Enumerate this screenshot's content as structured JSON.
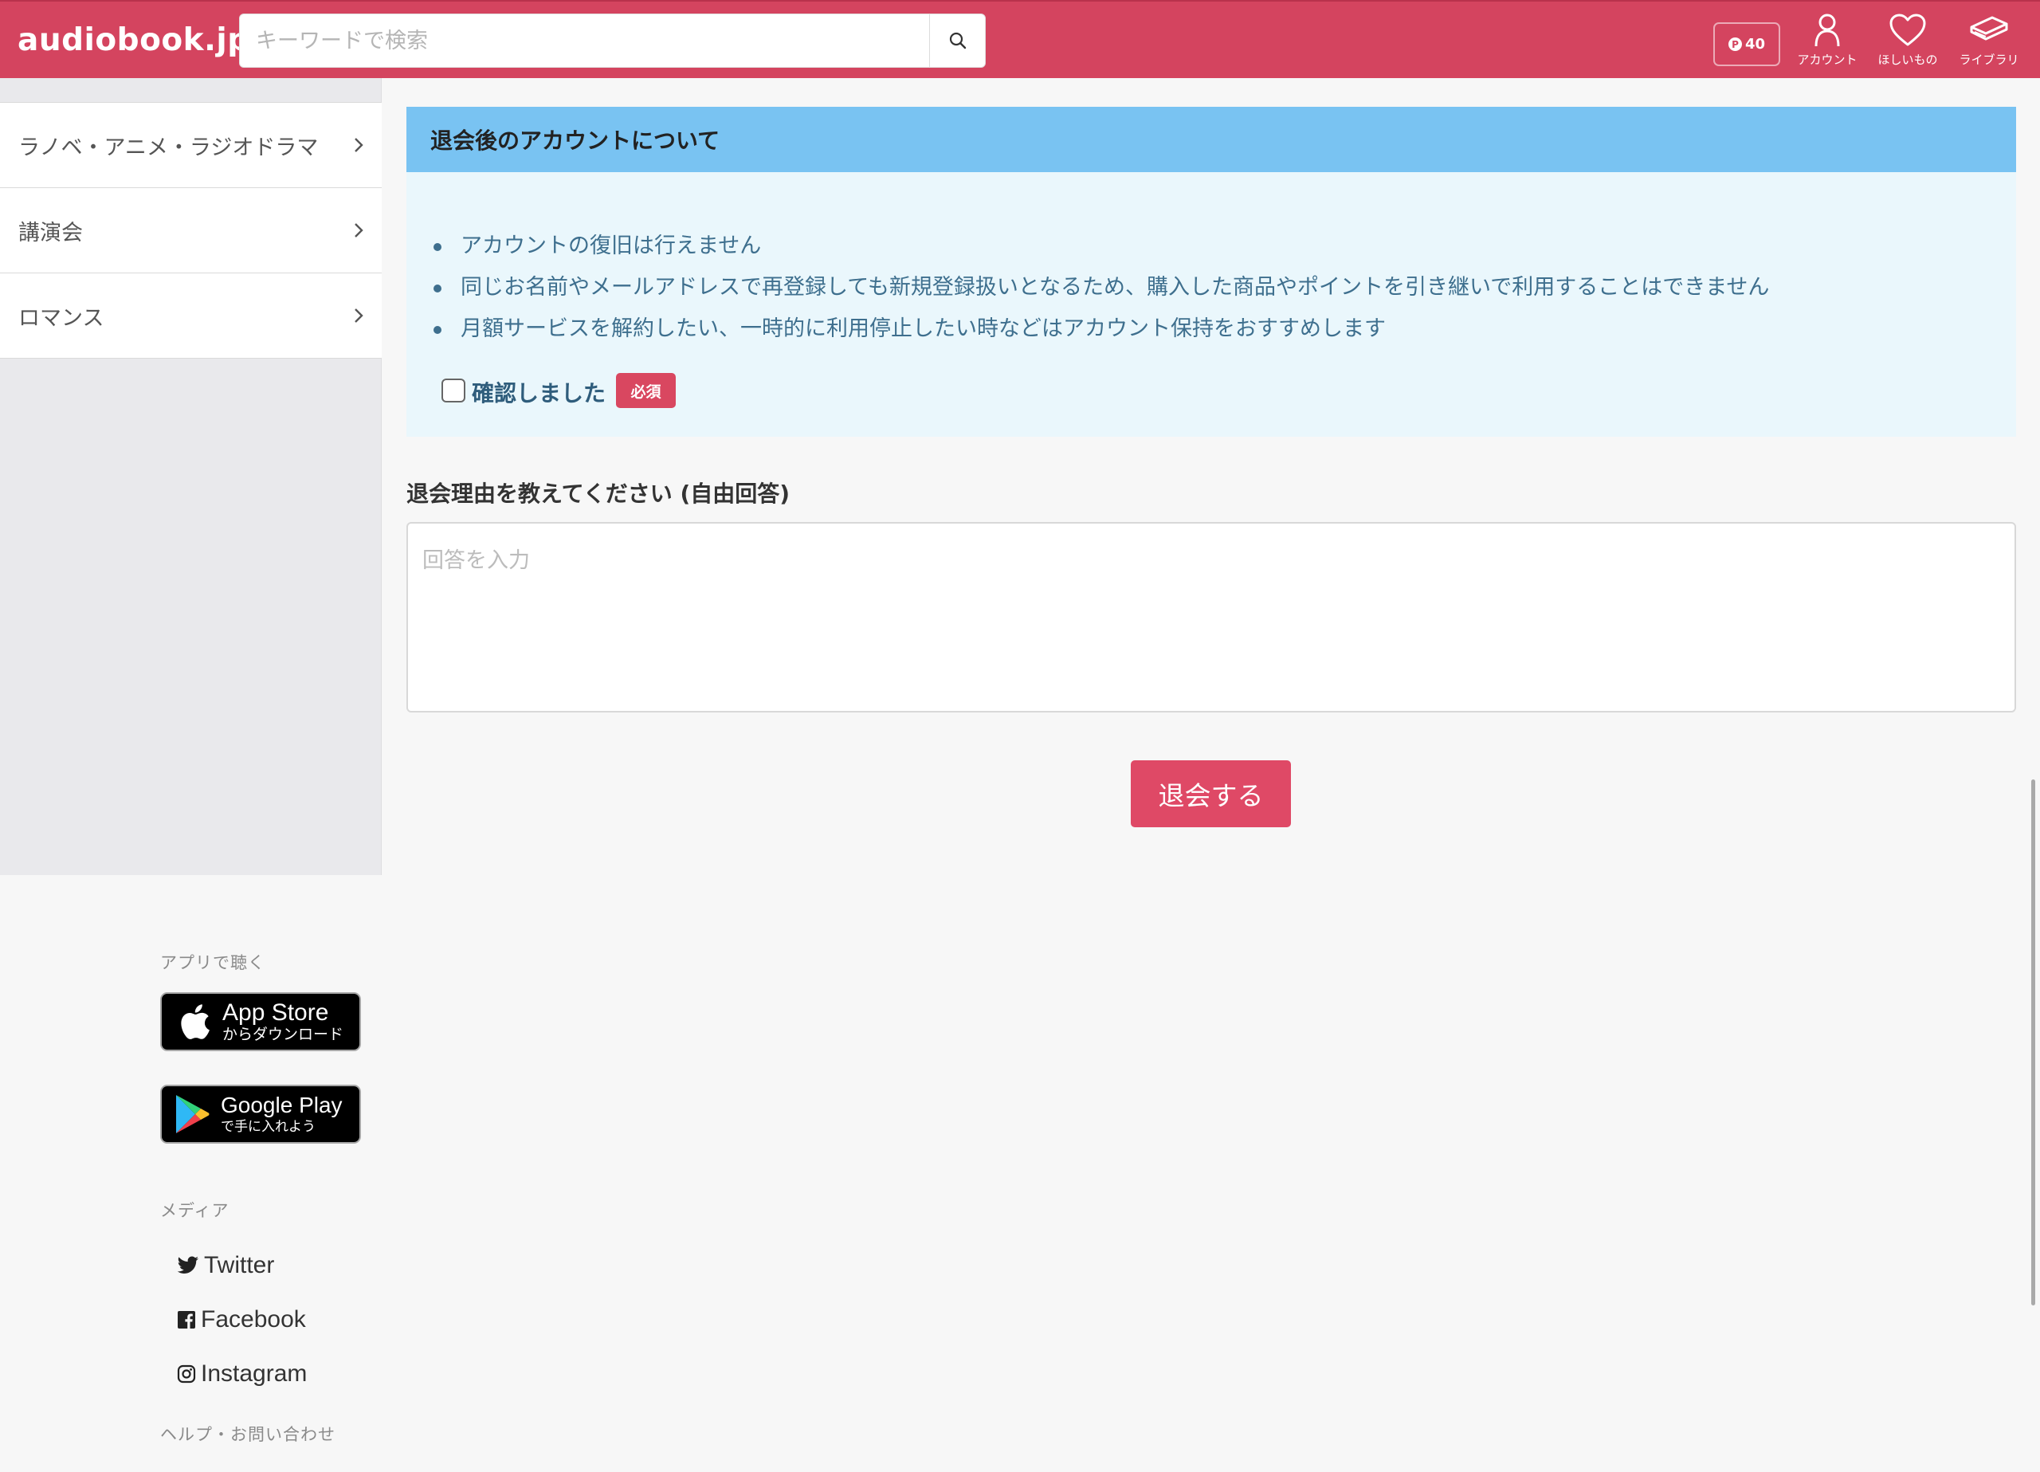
{
  "header": {
    "logo": "audiobook.jp",
    "search_placeholder": "キーワードで検索",
    "points": "40",
    "points_icon": "P",
    "nav": {
      "account": "アカウント",
      "wishlist": "ほしいもの",
      "library": "ライブラリ"
    }
  },
  "sidebar": {
    "items": [
      {
        "label": "ラノベ・アニメ・ラジオドラマ"
      },
      {
        "label": "講演会"
      },
      {
        "label": "ロマンス"
      }
    ]
  },
  "withdraw": {
    "info_title": "退会後のアカウントについて",
    "notes": [
      "アカウントの復旧は行えません",
      "同じお名前やメールアドレスで再登録しても新規登録扱いとなるため、購入した商品やポイントを引き継いで利用することはできません",
      "月額サービスを解約したい、一時的に利用停止したい時などはアカウント保持をおすすめします"
    ],
    "confirm_label": "確認しました",
    "required_badge": "必須",
    "reason_label": "退会理由を教えてください (自由回答)",
    "reason_placeholder": "回答を入力",
    "submit_label": "退会する"
  },
  "footer": {
    "app_heading": "アプリで聴く",
    "app_store": {
      "main": "App Store",
      "sub": "からダウンロード"
    },
    "google_play": {
      "main": "Google Play",
      "sub": "で手に入れよう"
    },
    "media_heading": "メディア",
    "media_links": {
      "twitter": "Twitter",
      "facebook": "Facebook",
      "instagram": "Instagram"
    },
    "help_heading": "ヘルプ・お問い合わせ"
  },
  "colors": {
    "brand": "#d4445f",
    "info_header": "#79c3f2",
    "info_bg": "#eaf7fc",
    "submit": "#df4966"
  }
}
